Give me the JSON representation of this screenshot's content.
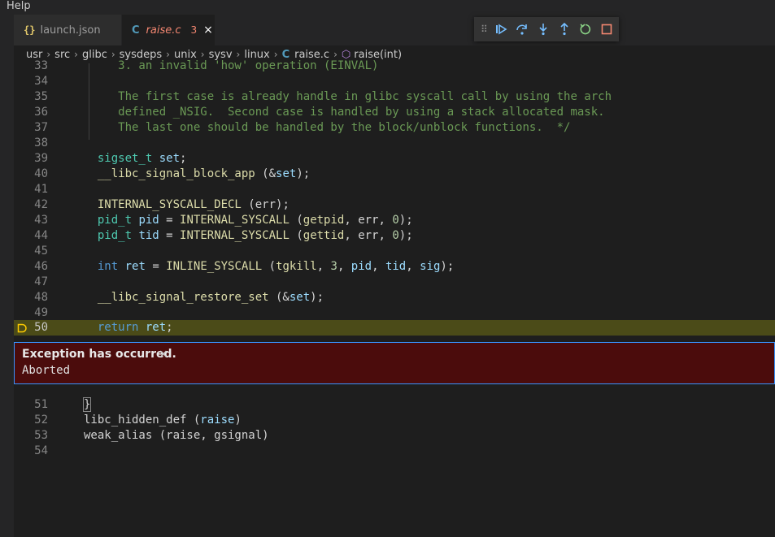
{
  "menu": {
    "help": "Help"
  },
  "tabs": [
    {
      "icon": "{}",
      "label": "launch.json"
    },
    {
      "icon": "C",
      "label": "raise.c",
      "problems": "3",
      "close": "×"
    }
  ],
  "breadcrumb": [
    "usr",
    "src",
    "glibc",
    "sysdeps",
    "unix",
    "sysv",
    "linux"
  ],
  "breadcrumb_file": "raise.c",
  "breadcrumb_symbol": "raise(int)",
  "exception": {
    "title": "Exception has occurred.",
    "close": "×",
    "message": "Aborted"
  },
  "code": {
    "l33": "     3. an invalid 'how' operation (EINVAL)",
    "l35": "     The first case is already handle in glibc syscall call by using the arch",
    "l36": "     defined _NSIG.  Second case is handled by using a stack allocated mask.",
    "l37": "     The last one should be handled by the block/unblock functions.  */",
    "l52_a": "libc_hidden_def (",
    "l52_b": "raise",
    "l52_c": ")",
    "l53": "weak_alias (raise, gsignal)"
  },
  "colors": {
    "accent": "#3794ff",
    "exception_bg": "#4b0c0c",
    "current_line": "#4b4b18"
  }
}
